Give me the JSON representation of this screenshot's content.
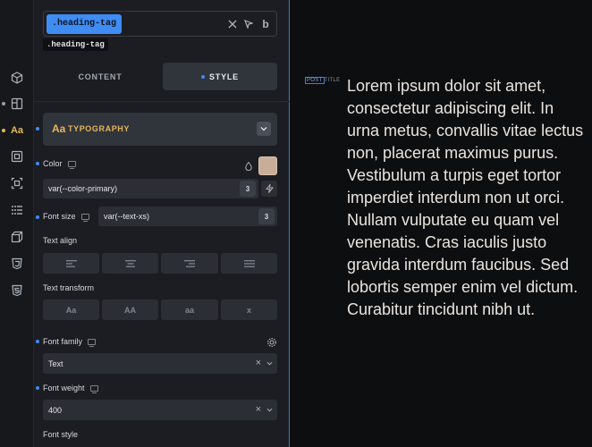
{
  "selector": {
    "chip": ".heading-tag",
    "tag": ".heading-tag",
    "icons": [
      "close-icon",
      "cursor-icon",
      "bold-b-icon"
    ],
    "b_label": "b"
  },
  "tabs": {
    "content": "CONTENT",
    "style": "STYLE"
  },
  "section": {
    "title": "TYPOGRAPHY",
    "icon_label": "Aa"
  },
  "color": {
    "label": "Color",
    "value": "var(--color-primary)",
    "swatch": "#c8ad98"
  },
  "font_size": {
    "label": "Font size",
    "value": "var(--text-xs)"
  },
  "text_align": {
    "label": "Text align"
  },
  "text_transform": {
    "label": "Text transform",
    "options": [
      "Aa",
      "AA",
      "aa",
      "x"
    ]
  },
  "font_family": {
    "label": "Font family",
    "value": "Text"
  },
  "font_weight": {
    "label": "Font weight",
    "value": "400"
  },
  "font_style": {
    "label": "Font style"
  },
  "rail_icon_letters": {
    "aa": "Aa"
  },
  "canvas": {
    "tag_label": "POST",
    "tag_suffix": "TITLE",
    "text": "Lorem ipsum dolor sit amet, consectetur adipiscing elit. In urna metus, convallis vitae lectus non, placerat maximus purus. Vestibulum a turpis eget tortor imperdiet interdum non ut orci. Nullam vulputate eu quam vel venenatis. Cras iaculis justo gravida interdum faucibus. Sed lobortis semper enim vel dictum. Curabitur tincidunt nibh ut."
  },
  "colors": {
    "accent": "#3f8cf3",
    "section": "#e5b75a",
    "text_color": "#e9e4df"
  }
}
